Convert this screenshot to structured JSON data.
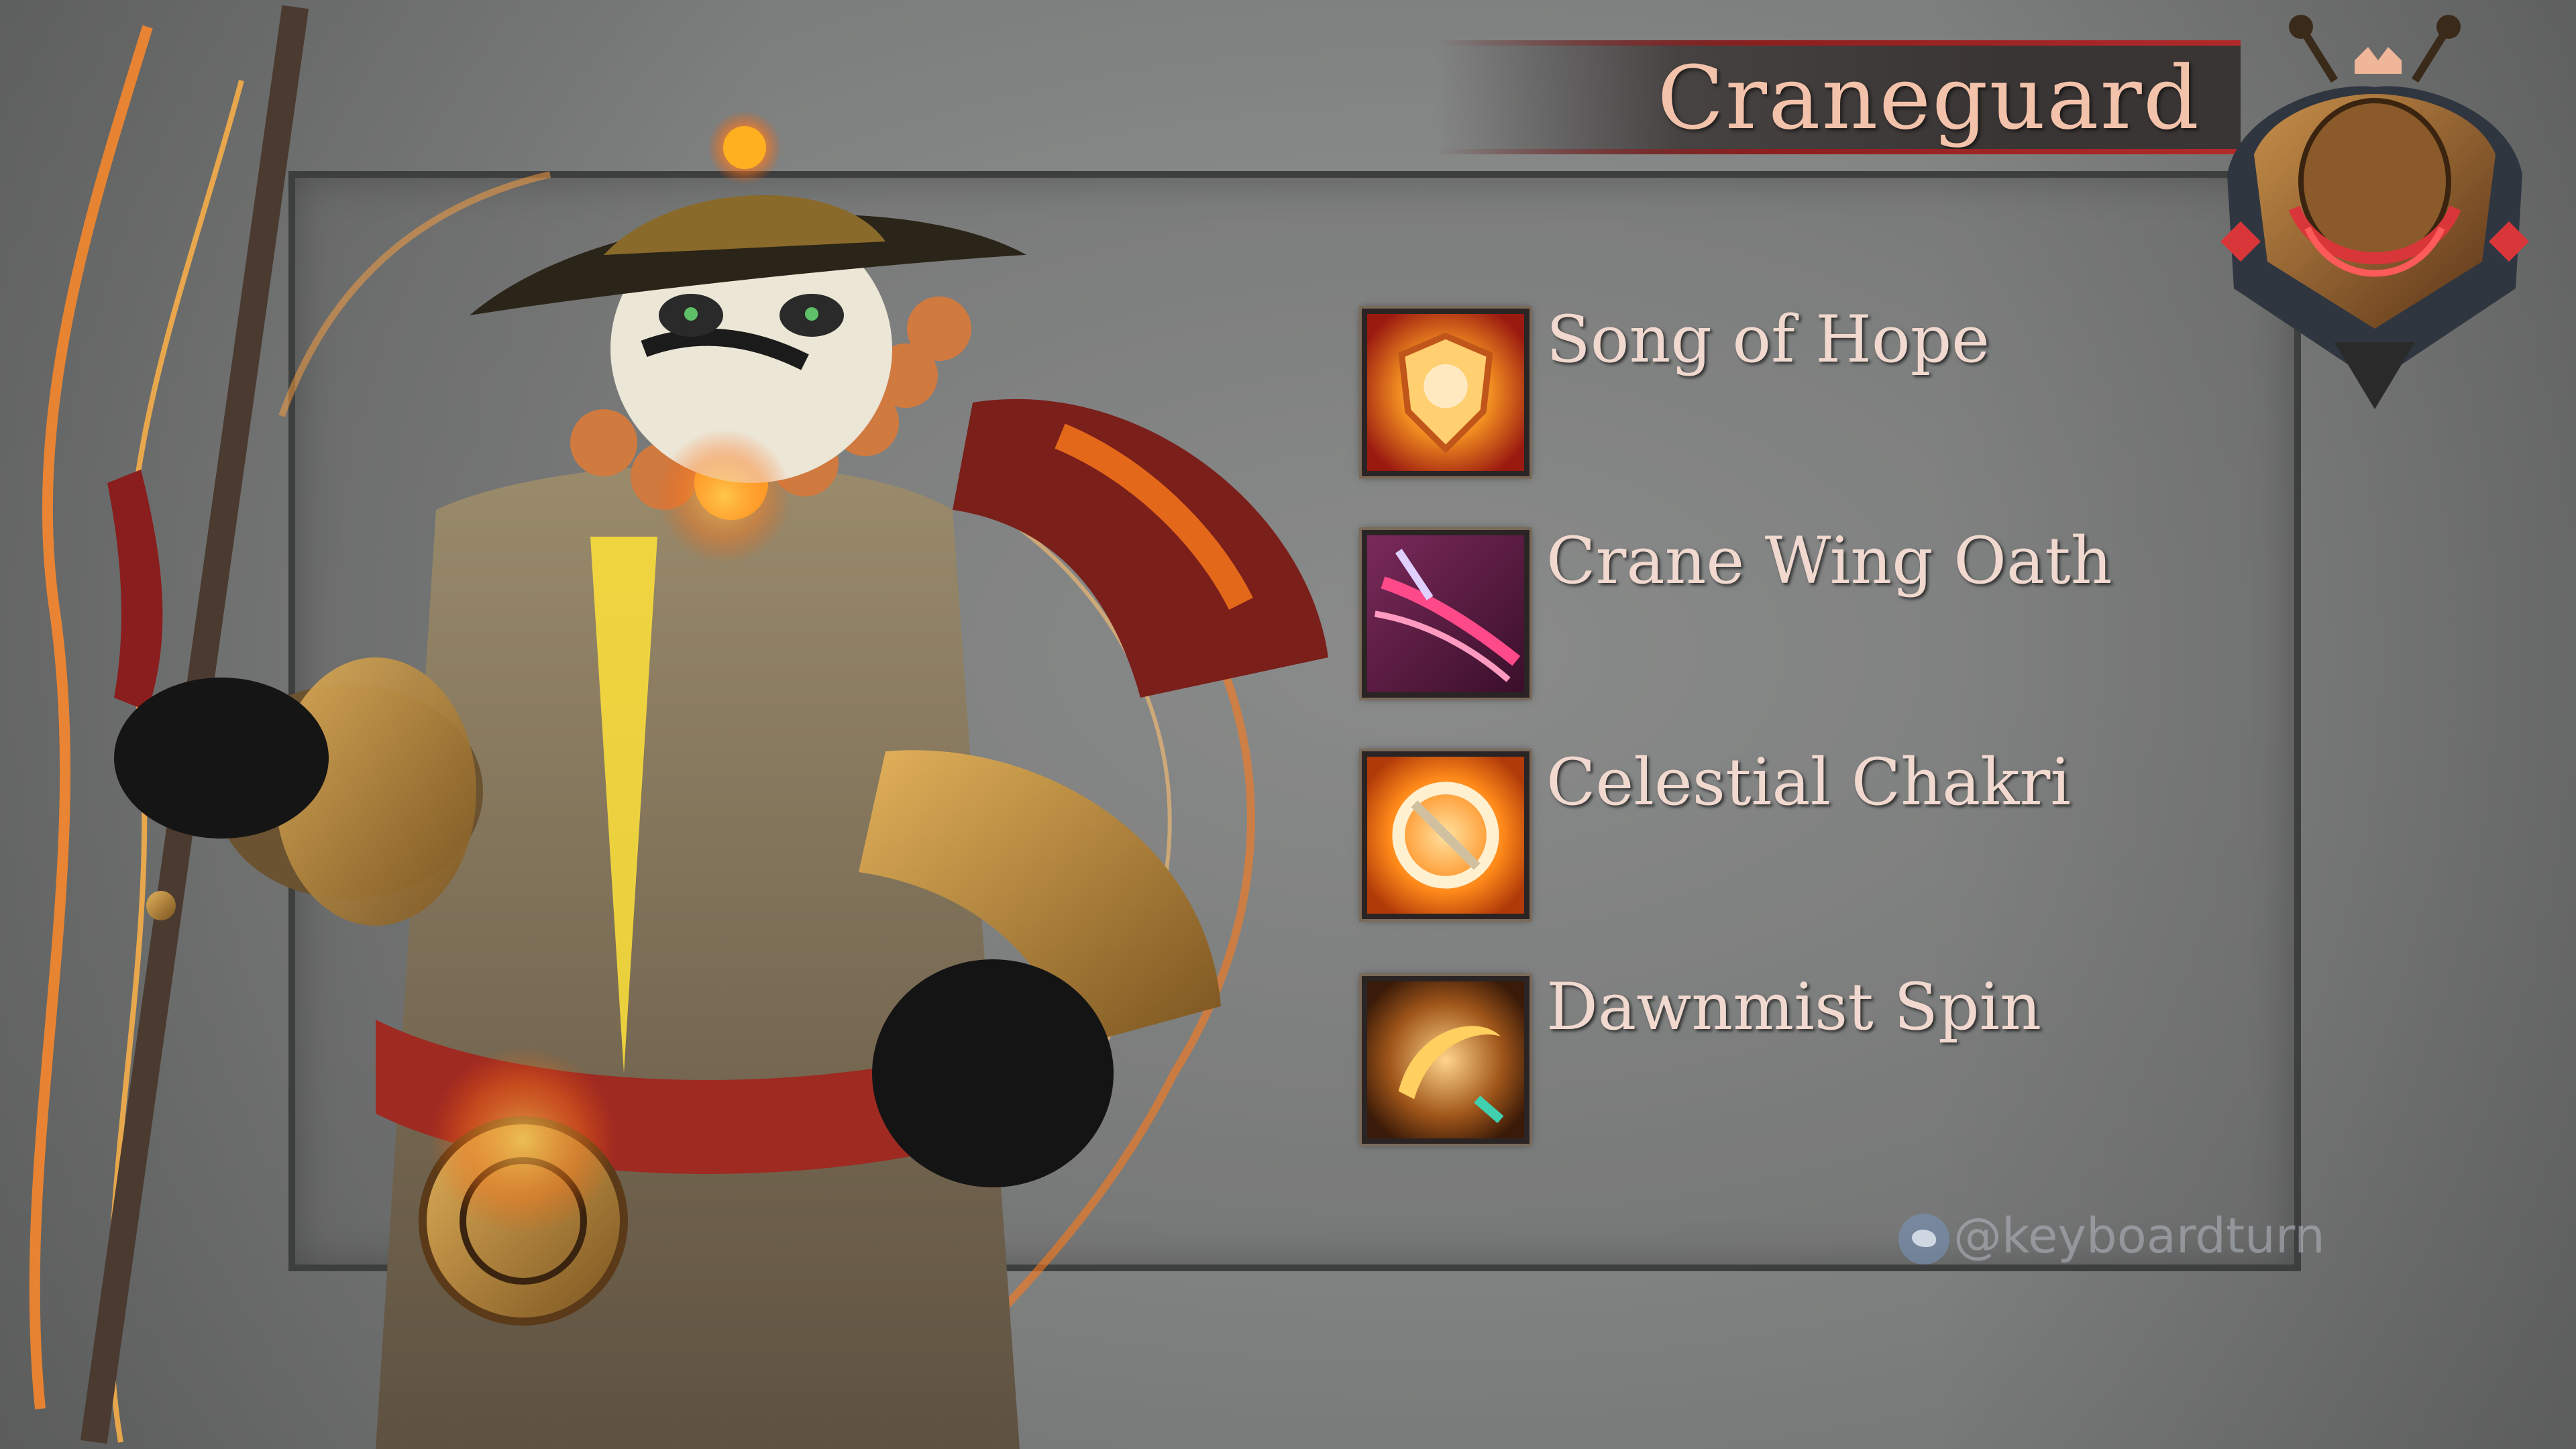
{
  "title": "Craneguard",
  "abilities": [
    {
      "label": "Song of Hope",
      "icon": "shield-crest-icon"
    },
    {
      "label": "Crane Wing Oath",
      "icon": "slash-streak-icon"
    },
    {
      "label": "Celestial Chakri",
      "icon": "chakram-icon"
    },
    {
      "label": "Dawnmist Spin",
      "icon": "spinning-blade-icon"
    }
  ],
  "watermark": {
    "icon": "twitter-bird-icon",
    "handle": "@keyboardturn"
  },
  "crest": {
    "icon": "lion-crest-icon"
  },
  "colors": {
    "title_text": "#f3c2aa",
    "label_text": "#f1d9d0",
    "banner_line": "#b22a2a",
    "frame": "#3d3e3e",
    "background": "#858786"
  }
}
